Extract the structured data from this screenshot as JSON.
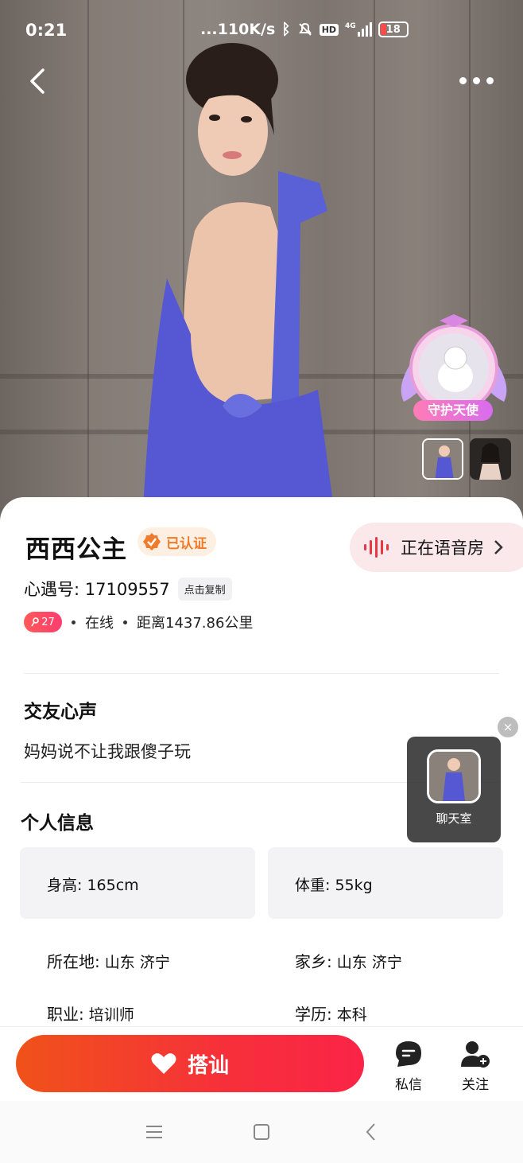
{
  "status_bar": {
    "time": "0:21",
    "network_speed": "...110K/s",
    "hd_label": "HD",
    "signal_label": "4G",
    "battery": "18"
  },
  "hero": {
    "angel_badge_label": "守护天使",
    "photo_count": 2
  },
  "profile": {
    "name": "西西公主",
    "verified_label": "已认证",
    "voice_room_label": "正在语音房",
    "id_label": "心遇号: 17109557",
    "copy_label": "点击复制",
    "level": "27",
    "online_status": "在线",
    "distance": "距离1437.86公里"
  },
  "sections": {
    "motto_title": "交友心声",
    "motto_text": "妈妈说不让我跟傻子玩",
    "info_title": "个人信息"
  },
  "info": {
    "height_label": "身高:",
    "height_value": "165cm",
    "weight_label": "体重:",
    "weight_value": "55kg",
    "location_label": "所在地:",
    "location_value": "山东 济宁",
    "hometown_label": "家乡:",
    "hometown_value": "山东 济宁",
    "job_label": "职业:",
    "job_value": "培训师",
    "education_label": "学历:",
    "education_value": "本科"
  },
  "floating": {
    "chatroom_label": "聊天室",
    "close_icon": "×"
  },
  "bottom_bar": {
    "approach_label": "搭讪",
    "message_label": "私信",
    "follow_label": "关注"
  },
  "colors": {
    "accent": "#f6303a",
    "verified": "#f07b2a",
    "voice_room_bg": "#fbe8ea"
  }
}
